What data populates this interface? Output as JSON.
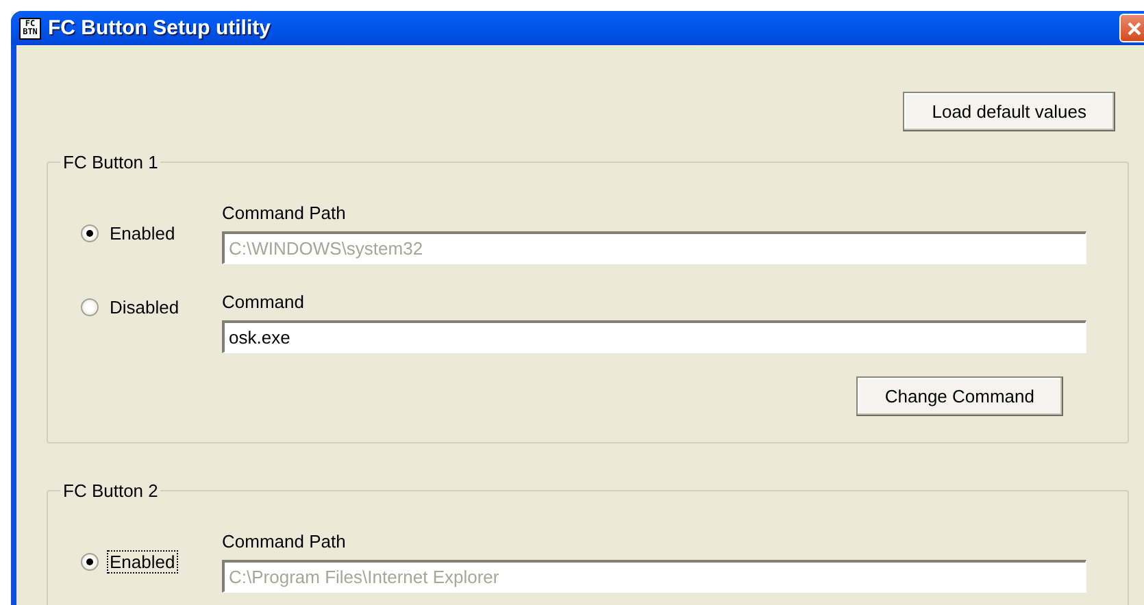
{
  "window": {
    "title": "FC Button Setup utility",
    "icon_text": "FC BTN"
  },
  "load_button": "Load default values",
  "groups": [
    {
      "legend": "FC Button 1",
      "rows": [
        {
          "radio": {
            "label": "Enabled",
            "selected": true,
            "focused": false
          },
          "field": {
            "label": "Command Path",
            "value": "C:\\WINDOWS\\system32",
            "disabled": true
          }
        },
        {
          "radio": {
            "label": "Disabled",
            "selected": false,
            "focused": false
          },
          "field": {
            "label": "Command",
            "value": "osk.exe",
            "disabled": false
          }
        }
      ],
      "button": "Change Command"
    },
    {
      "legend": "FC Button 2",
      "rows": [
        {
          "radio": {
            "label": "Enabled",
            "selected": true,
            "focused": true
          },
          "field": {
            "label": "Command Path",
            "value": "C:\\Program Files\\Internet Explorer",
            "disabled": true
          }
        }
      ]
    }
  ]
}
